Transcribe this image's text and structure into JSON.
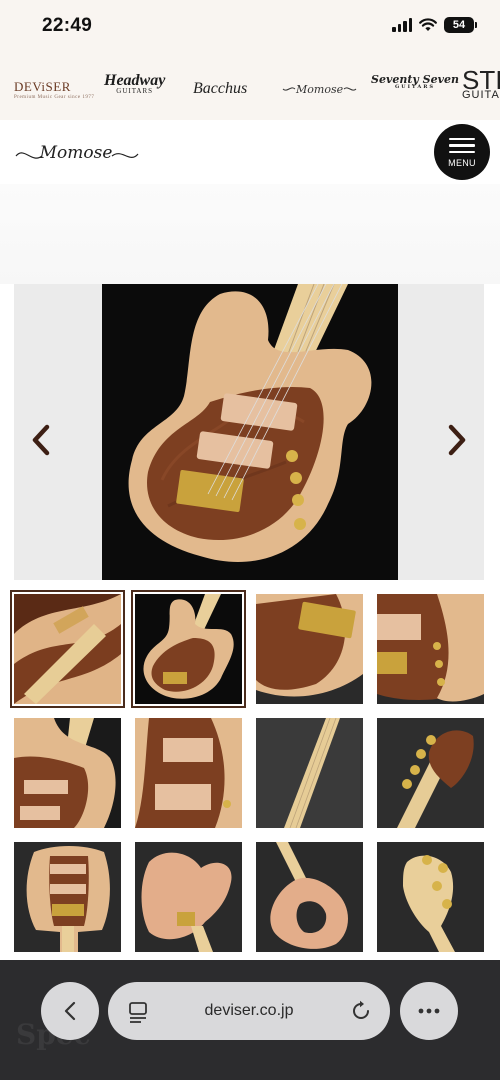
{
  "status": {
    "time": "22:49",
    "battery": "54"
  },
  "brands": {
    "deviser": "DEViSER",
    "deviser_tag": "Premium Music Gear since 1977",
    "headway": "Headway",
    "headway_sub": "GUITARS",
    "bacchus": "Bacchus",
    "momose": "Momose",
    "seventy": "Seventy Seven",
    "seventy_sub": "GUITARS",
    "sti": "STI",
    "sti_sub": "GUITA"
  },
  "header": {
    "logo_text": "Momose",
    "menu_label": "MENU"
  },
  "gallery": {
    "prev_icon": "chevron-left-icon",
    "next_icon": "chevron-right-icon",
    "thumbnail_count": 12,
    "selected_index": 1
  },
  "browser": {
    "url": "deviser.co.jp",
    "faded_text": "Spec"
  },
  "colors": {
    "accent": "#4a2b1c",
    "menu_bg": "#111111",
    "browser_bg": "#2c2c2e",
    "pill": "#d9d9db"
  }
}
